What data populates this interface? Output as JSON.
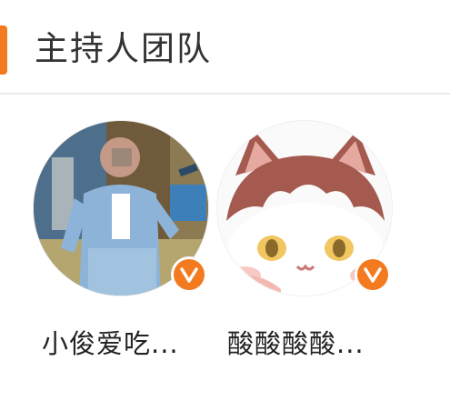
{
  "section": {
    "title": "主持人团队",
    "accent_color": "#f37a1f"
  },
  "hosts": [
    {
      "name": "小俊爱吃...",
      "avatar_icon": "person-photo-avatar",
      "verified_icon": "verified-v-badge"
    },
    {
      "name": "酸酸酸酸...",
      "avatar_icon": "cartoon-cat-avatar",
      "verified_icon": "verified-v-badge"
    }
  ]
}
